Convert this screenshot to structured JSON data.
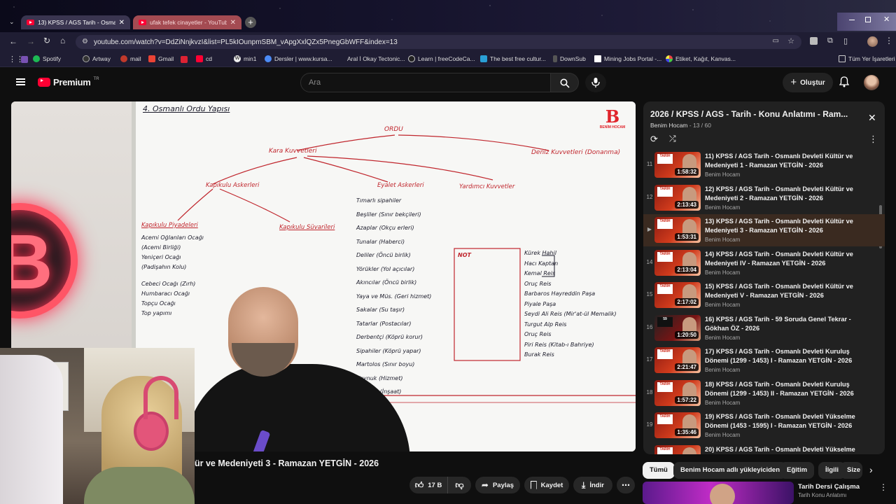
{
  "browser": {
    "tabs": [
      {
        "label": "13) KPSS / AGS Tarih - Osmanlı",
        "active": true
      },
      {
        "label": "ufak tefek cinayetler - YouTube",
        "active": false
      }
    ],
    "url": "youtube.com/watch?v=DdZiNnjkvzI&list=PL5kIOunpmSBM_vApgXxlQZx5PnegGbWFF&index=13",
    "bookmarks": [
      "Spotify",
      "Artway",
      "mail",
      "Gmail",
      "cd",
      "min1",
      "Dersler | www.kursa...",
      "Aral İ Okay Tectonic...",
      "Learn | freeCodeCa...",
      "The best free cultur...",
      "DownSub",
      "Mining Jobs Portal -...",
      "Etiket, Kağıt, Kanvas..."
    ],
    "other_bookmarks": "Tüm Yer İşaretleri"
  },
  "youtube": {
    "logo": "Premium",
    "logo_sup": "TR",
    "search_placeholder": "Ara",
    "create_label": "Oluştur"
  },
  "video": {
    "title": "ür ve Medeniyeti 3 - Ramazan YETGİN - 2026",
    "likes": "17 B",
    "share_label": "Paylaş",
    "save_label": "Kaydet",
    "download_label": "İndir",
    "brand_top": "B",
    "brand_bottom": "BENİM HOCAM",
    "board": {
      "heading": "4. Osmanlı Ordu Yapısı",
      "root": "ORDU",
      "col1": "Kara Kuvvetleri",
      "col2": "Deniz Kuvvetleri (Donanma)",
      "sub1": "Kapıkulu Askerleri",
      "sub2": "Eyalet Askerleri",
      "sub3": "Yardımcı Kuvvetler",
      "sub4": "Kapıkulu Piyadeleri",
      "sub5": "Kapıkulu Süvarileri",
      "items_left": [
        "Acemi Oğlanları Ocağı",
        "(Acemi Birliği)",
        "Yeniçeri Ocağı",
        "(Padişahın Kolu)",
        "Cebeci Ocağı (Zırh)",
        "Humbaracı Ocağı",
        "Topçu Ocağı",
        "Top yapımı"
      ],
      "items_mid": [
        "Tımarlı sipahiler",
        "Beşliler (Sınır bekçileri)",
        "Azaplar (Okçu erleri)",
        "Tunalar (Haberci)",
        "Deliler (Öncü birlik)",
        "Yörükler (Yol açıcılar)",
        "Akıncılar (Öncü birlik)",
        "Yaya ve Müs. (Geri hizmet)",
        "Sakalar (Su taşır)",
        "Tatarlar (Postacılar)",
        "Derbentçi (Köprü korur)",
        "Sipahiler (Köprü yapar)",
        "Martolos (Sınır boyu)",
        "Voynuk (Hizmet)",
        "Lağımcı (İnşaat)"
      ],
      "items_right": [
        "Kürek Hahil",
        "Hacı Kaptan",
        "Kemal Reis",
        "Oruç Reis",
        "Barbaros Hayreddin Paşa",
        "Piyale Paşa",
        "Seydi Ali Reis (Mir'at-ül Memalik)",
        "Turgut Alp Reis",
        "Oruç Reis",
        "Piri Reis (Kitab-ı Bahriye)",
        "Burak Reis"
      ],
      "note": "NOT"
    }
  },
  "playlist": {
    "title": "2026 / KPSS / AGS -  Tarih - Konu Anlatımı - Ram...",
    "channel": "Benim Hocam",
    "progress": "13 / 60",
    "items": [
      {
        "index": "11",
        "title": "11) KPSS / AGS Tarih - Osmanlı Devleti Kültür ve Medeniyeti 1 - Ramazan YETGİN - 2026",
        "channel": "Benim Hocam",
        "duration": "1:58:32",
        "current": false
      },
      {
        "index": "12",
        "title": "12) KPSS / AGS Tarih - Osmanlı Devleti Kültür ve Medeniyeti 2 - Ramazan YETGİN - 2026",
        "channel": "Benim Hocam",
        "duration": "2:13:43",
        "current": false
      },
      {
        "index": "▶",
        "title": "13) KPSS / AGS Tarih - Osmanlı Devleti Kültür ve Medeniyeti 3 - Ramazan YETGİN - 2026",
        "channel": "Benim Hocam",
        "duration": "1:53:31",
        "current": true
      },
      {
        "index": "14",
        "title": "14) KPSS / AGS Tarih - Osmanlı Devleti Kültür ve Medeniyeti IV - Ramazan YETGİN - 2026",
        "channel": "Benim Hocam",
        "duration": "2:13:04",
        "current": false
      },
      {
        "index": "15",
        "title": "15) KPSS / AGS Tarih - Osmanlı Devleti Kültür ve Medeniyeti V - Ramazan YETGİN - 2026",
        "channel": "Benim Hocam",
        "duration": "2:17:02",
        "current": false
      },
      {
        "index": "16",
        "title": "16) KPSS / AGS Tarih - 59 Soruda Genel Tekrar - Gökhan ÖZ - 2026",
        "channel": "Benim Hocam",
        "duration": "1:20:50",
        "current": false
      },
      {
        "index": "17",
        "title": "17) KPSS / AGS Tarih - Osmanlı Devleti Kuruluş Dönemi (1299 - 1453) I - Ramazan YETGİN - 2026",
        "channel": "Benim Hocam",
        "duration": "2:21:47",
        "current": false
      },
      {
        "index": "18",
        "title": "18) KPSS / AGS Tarih - Osmanlı Devleti Kuruluş Dönemi (1299 - 1453) II - Ramazan YETGİN - 2026",
        "channel": "Benim Hocam",
        "duration": "1:57:22",
        "current": false
      },
      {
        "index": "19",
        "title": "19) KPSS / AGS Tarih - Osmanlı Devleti Yükselme Dönemi (1453 - 1595) I - Ramazan YETGİN - 2026",
        "channel": "Benim Hocam",
        "duration": "1:35:46",
        "current": false
      },
      {
        "index": "20",
        "title": "20) KPSS / AGS Tarih - Osmanlı Devleti Yükselme",
        "channel": "",
        "duration": "",
        "current": false
      }
    ]
  },
  "chips": [
    "Tümü",
    "Benim Hocam adlı yükleyiciden",
    "Eğitim",
    "İlgili",
    "Size"
  ],
  "recommended": {
    "title": "Tarih Dersi Çalışma",
    "subtitle": "Tarih Konu Anlatımı"
  }
}
